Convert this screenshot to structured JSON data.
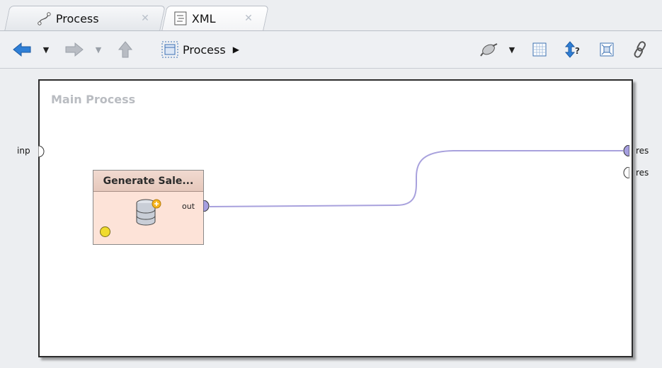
{
  "tabs": [
    {
      "label": "Process",
      "icon": "process-flow-icon",
      "close": "✕"
    },
    {
      "label": "XML",
      "icon": "xml-document-icon",
      "close": "✕"
    }
  ],
  "toolbar": {
    "back_icon": "back-arrow-icon",
    "forward_icon": "forward-arrow-icon",
    "up_icon": "up-arrow-icon",
    "breadcrumb": {
      "label": "Process",
      "icon": "process-frame-icon"
    },
    "right_icons": [
      "wiring-icon",
      "grid-icon",
      "order-icon",
      "fit-icon",
      "link-icon"
    ]
  },
  "process": {
    "title": "Main Process",
    "input_port": "inp",
    "output_ports": [
      "res",
      "res"
    ]
  },
  "operator": {
    "name": "Generate Sale...",
    "output_port": "out",
    "icon": "database-icon",
    "status": "yellow",
    "status_color": "#f0db2e"
  },
  "colors": {
    "connection": "#a8a1dd",
    "port_filled": "#a69fe0",
    "operator_bg": "#fde3d8"
  }
}
